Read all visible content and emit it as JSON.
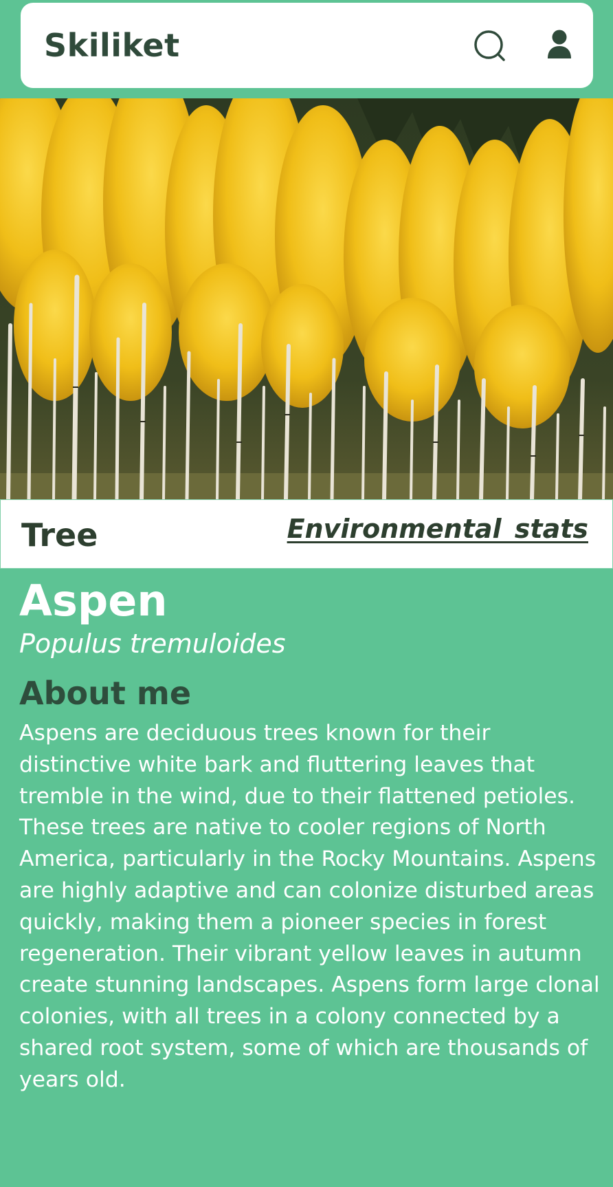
{
  "app": {
    "brand": "Skiliket"
  },
  "icons": {
    "search": "search-icon",
    "user": "user-icon"
  },
  "plant": {
    "type": "Tree",
    "env_link": "Environmental stats",
    "common_name": "Aspen",
    "scientific_name": "Populus tremuloides",
    "about_title": "About me",
    "about_text": "Aspens are deciduous trees known for their distinctive white bark and fluttering leaves that tremble in the wind, due to their flattened petioles. These trees are native to cooler regions of North America, particularly in the Rocky Mountains. Aspens are highly adaptive and can colonize disturbed areas quickly, making them a pioneer species in forest regeneration. Their vibrant yellow leaves in autumn create stunning landscapes. Aspens form large clonal colonies, with all trees in a colony connected by a shared root system, some of which are thousands of years old."
  },
  "colors": {
    "background": "#5dc394",
    "text_dark": "#2f4a3a",
    "foliage_yellow": "#f2c21c",
    "bark_white": "#e9e4d6"
  }
}
